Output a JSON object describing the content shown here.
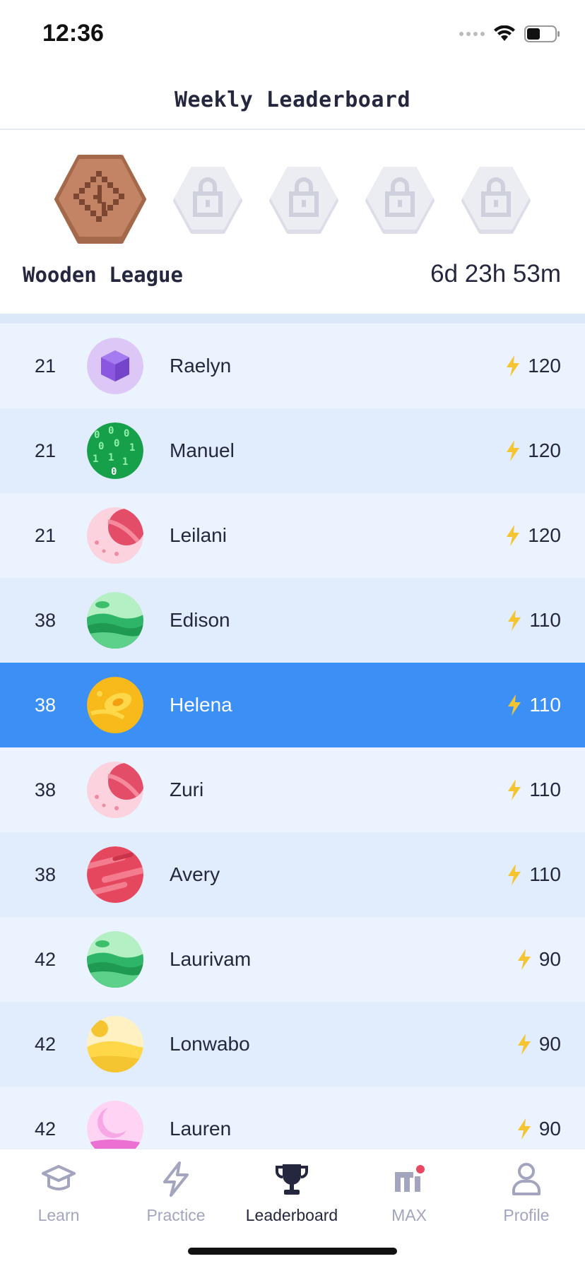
{
  "status_bar": {
    "time": "12:36"
  },
  "header": {
    "title": "Weekly Leaderboard"
  },
  "league": {
    "name": "Wooden League",
    "time_remaining": "6d 23h 53m",
    "badges": [
      "wooden-league-badge",
      "locked-league-badge",
      "locked-league-badge",
      "locked-league-badge",
      "locked-league-badge"
    ]
  },
  "leaderboard": [
    {
      "rank": "21",
      "name": "Raelyn",
      "score": "120",
      "avatar": "purple-cube-avatar"
    },
    {
      "rank": "21",
      "name": "Manuel",
      "score": "120",
      "avatar": "binary-code-avatar"
    },
    {
      "rank": "21",
      "name": "Leilani",
      "score": "120",
      "avatar": "pink-planet-avatar"
    },
    {
      "rank": "38",
      "name": "Edison",
      "score": "110",
      "avatar": "green-hills-avatar"
    },
    {
      "rank": "38",
      "name": "Helena",
      "score": "110",
      "avatar": "yellow-planet-avatar",
      "current_user": true
    },
    {
      "rank": "38",
      "name": "Zuri",
      "score": "110",
      "avatar": "pink-planet-avatar"
    },
    {
      "rank": "38",
      "name": "Avery",
      "score": "110",
      "avatar": "red-striped-planet-avatar"
    },
    {
      "rank": "42",
      "name": "Laurivam",
      "score": "90",
      "avatar": "green-hills-avatar"
    },
    {
      "rank": "42",
      "name": "Lonwabo",
      "score": "90",
      "avatar": "desert-avatar"
    },
    {
      "rank": "42",
      "name": "Lauren",
      "score": "90",
      "avatar": "pink-moon-avatar"
    }
  ],
  "tabs": [
    {
      "label": "Learn",
      "icon": "graduation-cap-icon"
    },
    {
      "label": "Practice",
      "icon": "lightning-icon"
    },
    {
      "label": "Leaderboard",
      "icon": "trophy-icon",
      "active": true
    },
    {
      "label": "MAX",
      "icon": "max-logo-icon"
    },
    {
      "label": "Profile",
      "icon": "person-icon"
    }
  ],
  "colors": {
    "accent": "#3b8ff5",
    "bolt": "#f5c431",
    "text": "#25273f",
    "tab_inactive": "#a2a5bd"
  }
}
